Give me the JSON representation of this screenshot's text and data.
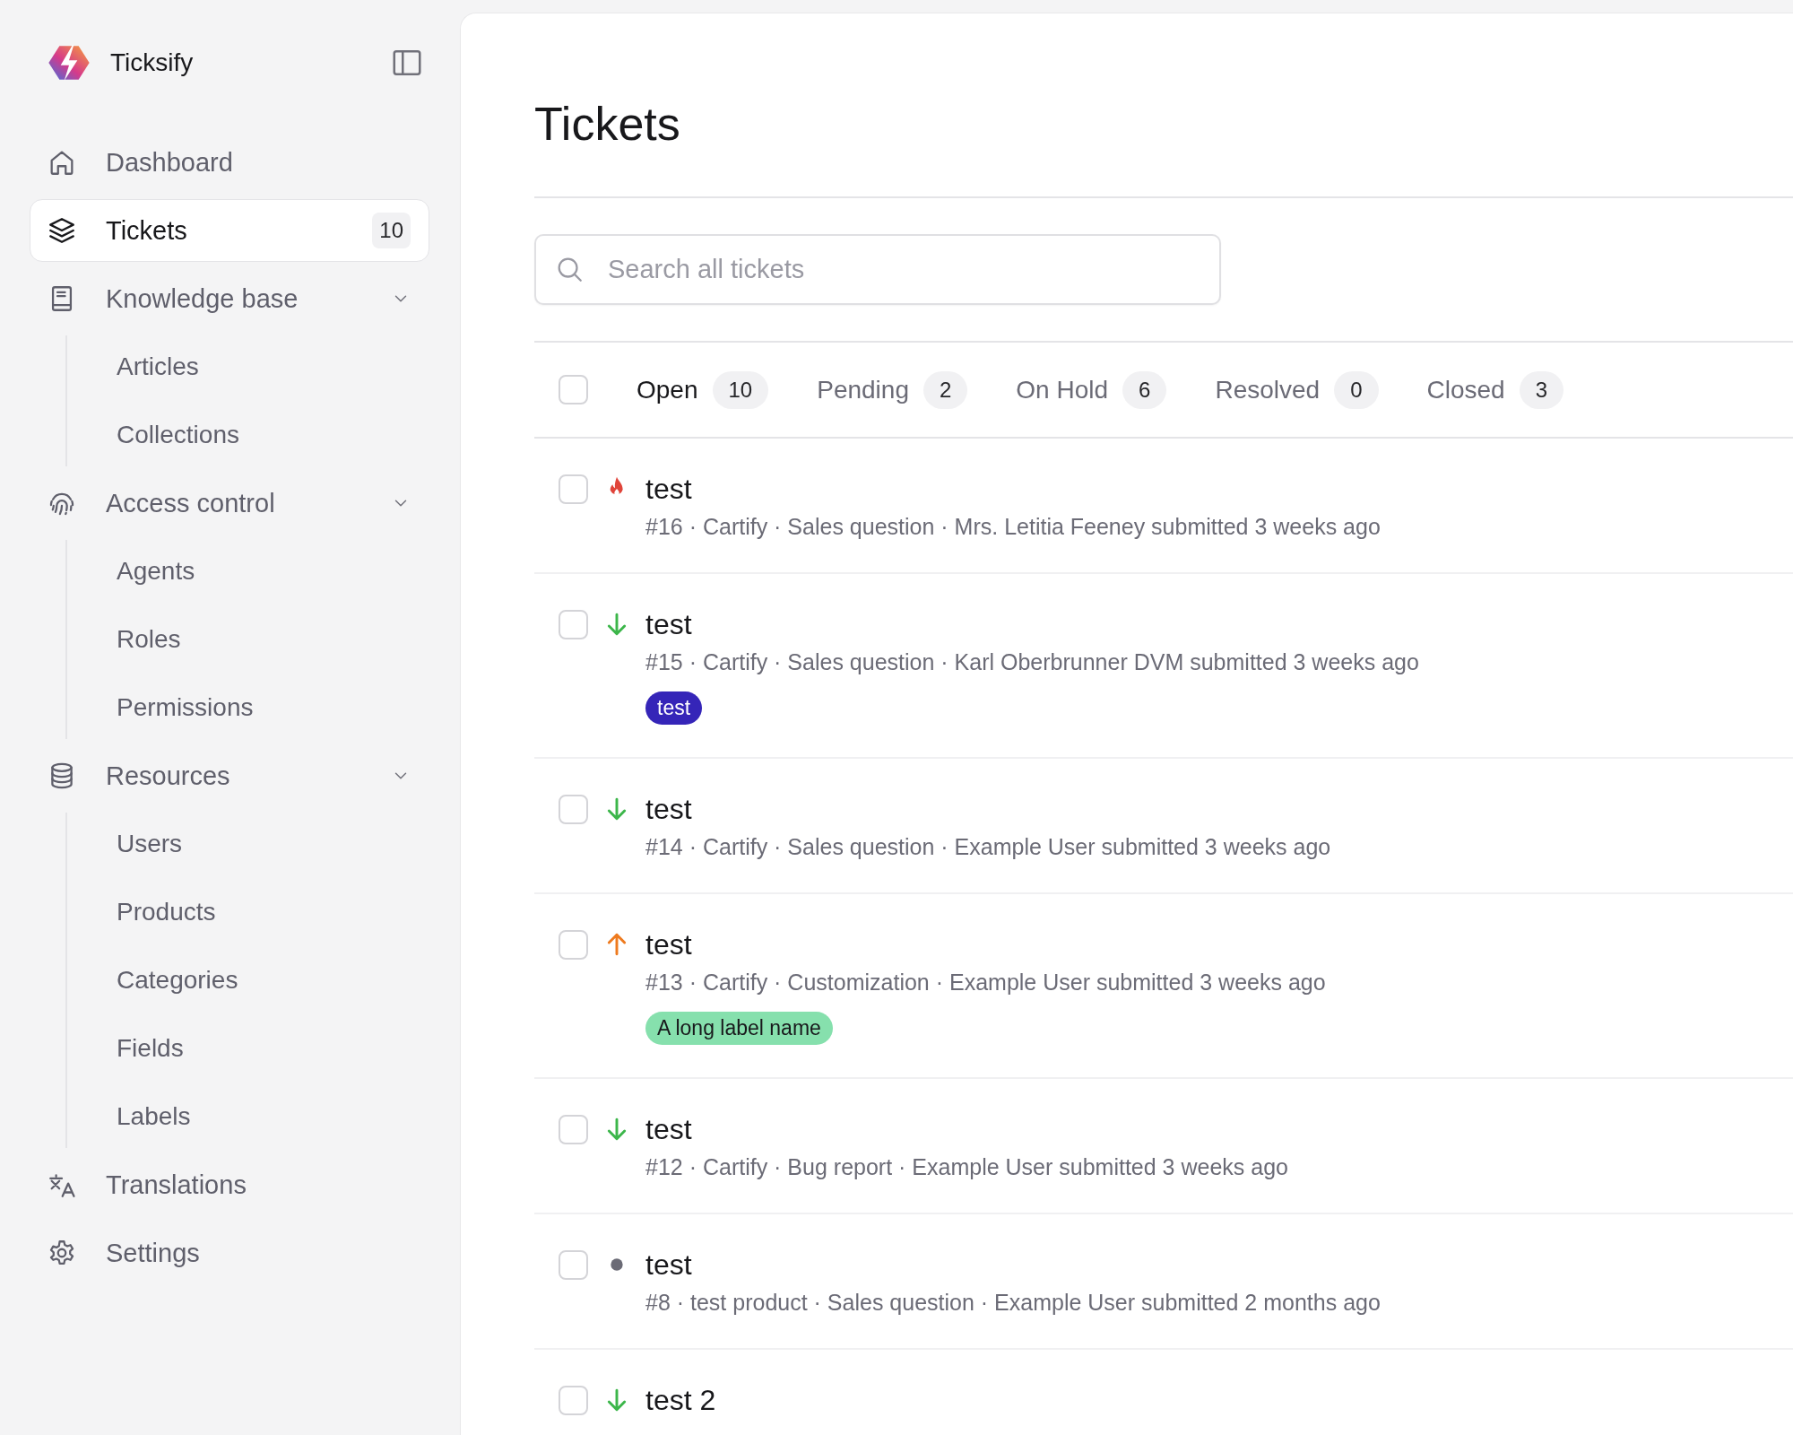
{
  "brand": {
    "name": "Ticksify"
  },
  "sidebar": {
    "items": [
      {
        "kind": "home",
        "label": "Dashboard",
        "selected": false
      },
      {
        "kind": "layers",
        "label": "Tickets",
        "selected": true,
        "badge": "10"
      },
      {
        "kind": "book",
        "label": "Knowledge base",
        "selected": false,
        "expanded": true,
        "children": [
          {
            "label": "Articles",
            "selected": false
          },
          {
            "label": "Collections",
            "selected": false
          }
        ]
      },
      {
        "kind": "fingerprint",
        "label": "Access control",
        "selected": false,
        "expanded": true,
        "children": [
          {
            "label": "Agents",
            "selected": false
          },
          {
            "label": "Roles",
            "selected": false
          },
          {
            "label": "Permissions",
            "selected": false
          }
        ]
      },
      {
        "kind": "database",
        "label": "Resources",
        "selected": false,
        "expanded": true,
        "children": [
          {
            "label": "Users",
            "selected": false
          },
          {
            "label": "Products",
            "selected": false
          },
          {
            "label": "Categories",
            "selected": false
          },
          {
            "label": "Fields",
            "selected": false
          },
          {
            "label": "Labels",
            "selected": false
          }
        ]
      },
      {
        "kind": "translate",
        "label": "Translations",
        "selected": false
      },
      {
        "kind": "gear",
        "label": "Settings",
        "selected": false
      }
    ]
  },
  "page": {
    "title": "Tickets"
  },
  "search": {
    "placeholder": "Search all tickets"
  },
  "select_all": {
    "checked": false
  },
  "tabs": [
    {
      "label": "Open",
      "count": "10",
      "selected": true
    },
    {
      "label": "Pending",
      "count": "2",
      "selected": false
    },
    {
      "label": "On Hold",
      "count": "6",
      "selected": false
    },
    {
      "label": "Resolved",
      "count": "0",
      "selected": false
    },
    {
      "label": "Closed",
      "count": "3",
      "selected": false
    }
  ],
  "tickets": [
    {
      "checked": false,
      "kind": "urgent",
      "title": "test",
      "meta": "#16 · Cartify · Sales question · Mrs. Letitia Feeney submitted 3 weeks ago"
    },
    {
      "checked": false,
      "kind": "low",
      "title": "test",
      "meta": "#15 · Cartify · Sales question · Karl Oberbrunner DVM submitted 3 weeks ago",
      "labels": [
        {
          "text": "test",
          "color": "#3525b8"
        }
      ]
    },
    {
      "checked": false,
      "kind": "low",
      "title": "test",
      "meta": "#14 · Cartify · Sales question · Example User submitted 3 weeks ago"
    },
    {
      "checked": false,
      "kind": "high",
      "title": "test",
      "meta": "#13 · Cartify · Customization · Example User submitted 3 weeks ago",
      "labels": [
        {
          "text": "A long label name",
          "color": "#86e0ad"
        }
      ]
    },
    {
      "checked": false,
      "kind": "low",
      "title": "test",
      "meta": "#12 · Cartify · Bug report · Example User submitted 3 weeks ago"
    },
    {
      "checked": false,
      "kind": "none",
      "title": "test",
      "meta": "#8 · test product · Sales question · Example User submitted 2 months ago"
    },
    {
      "checked": false,
      "kind": "low",
      "title": "test 2"
    }
  ]
}
